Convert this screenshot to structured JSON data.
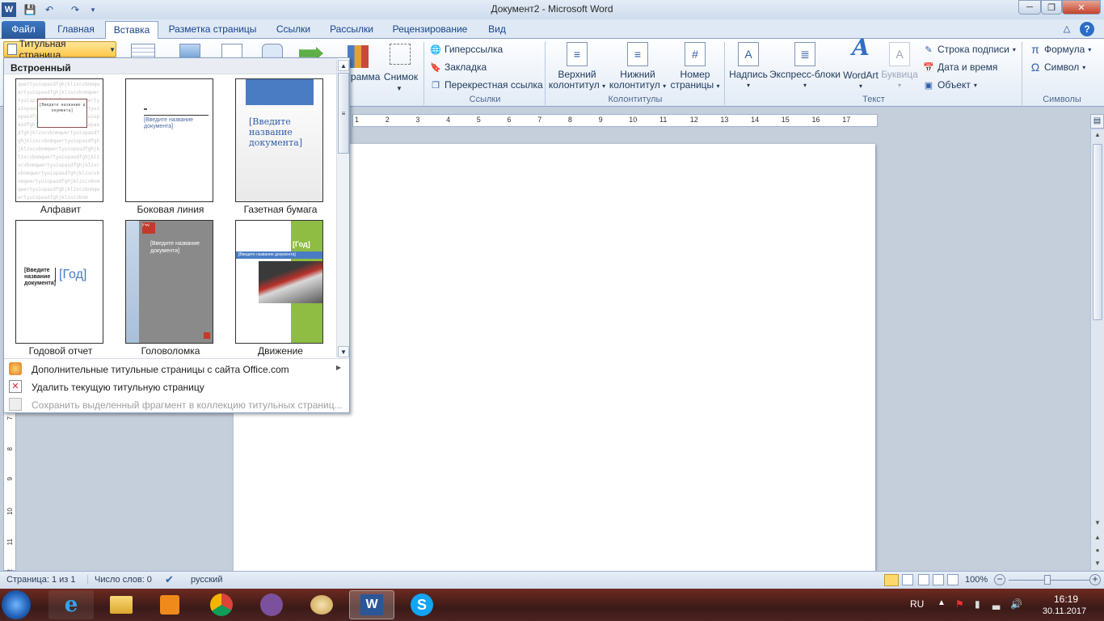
{
  "window": {
    "title": "Документ2  -  Microsoft Word",
    "app_icon": "W",
    "controls": {
      "minimize": "─",
      "maximize": "❐",
      "close": "✕"
    }
  },
  "tabs": {
    "file": "Файл",
    "items": [
      "Главная",
      "Вставка",
      "Разметка страницы",
      "Ссылки",
      "Рассылки",
      "Рецензирование",
      "Вид"
    ],
    "active": "Вставка"
  },
  "ribbon": {
    "cover_page_button": "Титульная страница",
    "chart_fragment": "грамма",
    "screenshot": "Снимок",
    "links_group": {
      "label": "Ссылки",
      "items": [
        "Гиперссылка",
        "Закладка",
        "Перекрестная ссылка"
      ]
    },
    "header_footer_group": {
      "label": "Колонтитулы",
      "header": [
        "Верхний",
        "колонтитул"
      ],
      "footer": [
        "Нижний",
        "колонтитул"
      ],
      "page_number": [
        "Номер",
        "страницы"
      ]
    },
    "text_group": {
      "label": "Текст",
      "textbox": "Надпись",
      "quickparts": "Экспресс-блоки",
      "wordart": "WordArt",
      "dropcap": "Буквица",
      "signature": "Строка подписи",
      "datetime": "Дата и время",
      "object": "Объект"
    },
    "symbols_group": {
      "label": "Символы",
      "equation": "Формула",
      "symbol": "Символ"
    }
  },
  "dropdown": {
    "header": "Встроенный",
    "templates": [
      {
        "name": "Алфавит",
        "title": "[Введите название документа]"
      },
      {
        "name": "Боковая линия",
        "title": "[Введите название документа]"
      },
      {
        "name": "Газетная бумага",
        "title": "[Введите название документа]"
      },
      {
        "name": "Годовой отчет",
        "title": "[Введите название документа]",
        "year": "[Год]"
      },
      {
        "name": "Головоломка",
        "title": "[Введите название документа]",
        "year": "[Год]"
      },
      {
        "name": "Движение",
        "title": "[Введите название документа]",
        "year": "[Год]"
      }
    ],
    "menu": [
      {
        "label": "Дополнительные титульные страницы с сайта Office.com",
        "enabled": true
      },
      {
        "label": "Удалить текущую титульную страницу",
        "enabled": true
      },
      {
        "label": "Сохранить выделенный фрагмент в коллекцию титульных страниц...",
        "enabled": false
      }
    ]
  },
  "ruler_numbers": [
    "1",
    "2",
    "3",
    "4",
    "5",
    "6",
    "7",
    "8",
    "9",
    "10",
    "11",
    "12",
    "13",
    "14",
    "15",
    "16",
    "17"
  ],
  "vruler_numbers": [
    "7",
    "8",
    "9",
    "10",
    "11",
    "12"
  ],
  "statusbar": {
    "page": "Страница: 1 из 1",
    "words": "Число слов: 0",
    "language": "русский",
    "zoom": "100%"
  },
  "taskbar": {
    "lang": "RU",
    "time": "16:19",
    "date": "30.11.2017"
  },
  "colors": {
    "ribbon_accent": "#2b5797",
    "taskbar": "#5a2520"
  }
}
